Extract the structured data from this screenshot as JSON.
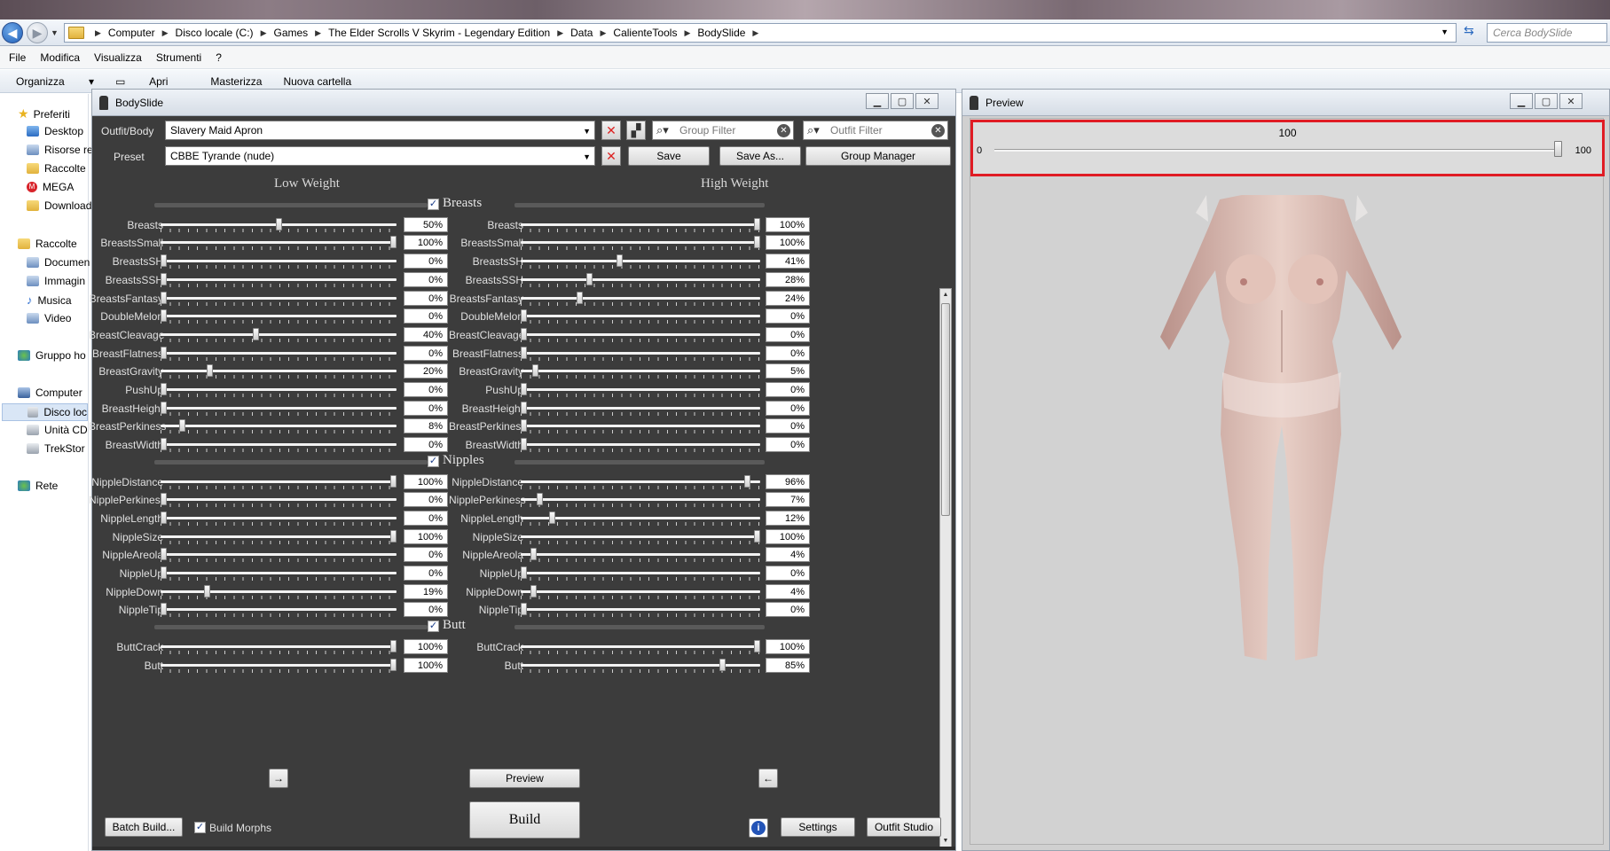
{
  "explorer": {
    "breadcrumbs": [
      "Computer",
      "Disco locale (C:)",
      "Games",
      "The Elder Scrolls V Skyrim - Legendary Edition",
      "Data",
      "CalienteTools",
      "BodySlide"
    ],
    "search_placeholder": "Cerca BodySlide",
    "menu": [
      "File",
      "Modifica",
      "Visualizza",
      "Strumenti",
      "?"
    ],
    "commands": {
      "organize": "Organizza",
      "open": "Apri",
      "burn": "Masterizza",
      "new_folder": "Nuova cartella"
    },
    "nav": {
      "favorites": "Preferiti",
      "desktop": "Desktop",
      "recent": "Risorse re",
      "collections": "Raccolte",
      "mega": "MEGA",
      "downloads": "Download",
      "libraries": "Raccolte",
      "documents": "Documen",
      "images": "Immagin",
      "music": "Musica",
      "video": "Video",
      "homegroup": "Gruppo ho",
      "computer": "Computer",
      "local_disk": "Disco loc",
      "cd_drive": "Unità CD",
      "trekstor": "TrekStor",
      "network": "Rete"
    }
  },
  "bodyslide": {
    "title": "BodySlide",
    "outfit_label": "Outfit/Body",
    "outfit_value": "Slavery Maid Apron",
    "preset_label": "Preset",
    "preset_value": "CBBE Tyrande (nude)",
    "group_filter_placeholder": "Group Filter",
    "outfit_filter_placeholder": "Outfit Filter",
    "save_label": "Save",
    "save_as_label": "Save As...",
    "group_manager_label": "Group Manager",
    "low_weight_label": "Low Weight",
    "high_weight_label": "High Weight",
    "groups": [
      {
        "name": "Breasts",
        "sliders": [
          {
            "name": "Breasts",
            "low": 50,
            "high": 100
          },
          {
            "name": "BreastsSmall",
            "low": 100,
            "high": 100
          },
          {
            "name": "BreastsSH",
            "low": 0,
            "high": 41
          },
          {
            "name": "BreastsSSH",
            "low": 0,
            "high": 28
          },
          {
            "name": "BreastsFantasy",
            "low": 0,
            "high": 24
          },
          {
            "name": "DoubleMelon",
            "low": 0,
            "high": 0
          },
          {
            "name": "BreastCleavage",
            "low": 40,
            "high": 0
          },
          {
            "name": "BreastFlatness",
            "low": 0,
            "high": 0
          },
          {
            "name": "BreastGravity",
            "low": 20,
            "high": 5
          },
          {
            "name": "PushUp",
            "low": 0,
            "high": 0
          },
          {
            "name": "BreastHeight",
            "low": 0,
            "high": 0
          },
          {
            "name": "BreastPerkiness",
            "low": 8,
            "high": 0
          },
          {
            "name": "BreastWidth",
            "low": 0,
            "high": 0
          }
        ]
      },
      {
        "name": "Nipples",
        "sliders": [
          {
            "name": "NippleDistance",
            "low": 100,
            "high": 96
          },
          {
            "name": "NipplePerkiness",
            "low": 0,
            "high": 7
          },
          {
            "name": "NippleLength",
            "low": 0,
            "high": 12
          },
          {
            "name": "NippleSize",
            "low": 100,
            "high": 100
          },
          {
            "name": "NippleAreola",
            "low": 0,
            "high": 4
          },
          {
            "name": "NippleUp",
            "low": 0,
            "high": 0
          },
          {
            "name": "NippleDown",
            "low": 19,
            "high": 4
          },
          {
            "name": "NippleTip",
            "low": 0,
            "high": 0
          }
        ]
      },
      {
        "name": "Butt",
        "sliders": [
          {
            "name": "ButtCrack",
            "low": 100,
            "high": 100
          },
          {
            "name": "Butt",
            "low": 100,
            "high": 85
          }
        ]
      }
    ],
    "copy_right_label": "→",
    "copy_left_label": "←",
    "preview_label": "Preview",
    "build_label": "Build",
    "batch_build_label": "Batch Build...",
    "build_morphs_label": "Build Morphs",
    "build_morphs_checked": true,
    "settings_label": "Settings",
    "outfit_studio_label": "Outfit Studio",
    "info_label": "i"
  },
  "preview": {
    "title": "Preview",
    "weight_value": "100",
    "weight_min": "0",
    "weight_max": "100",
    "weight_fraction": 1.0
  },
  "colors": {
    "window_bg": "#3c3c3c",
    "highlight": "#e01c24",
    "model_skin": "#d9b2a6"
  }
}
